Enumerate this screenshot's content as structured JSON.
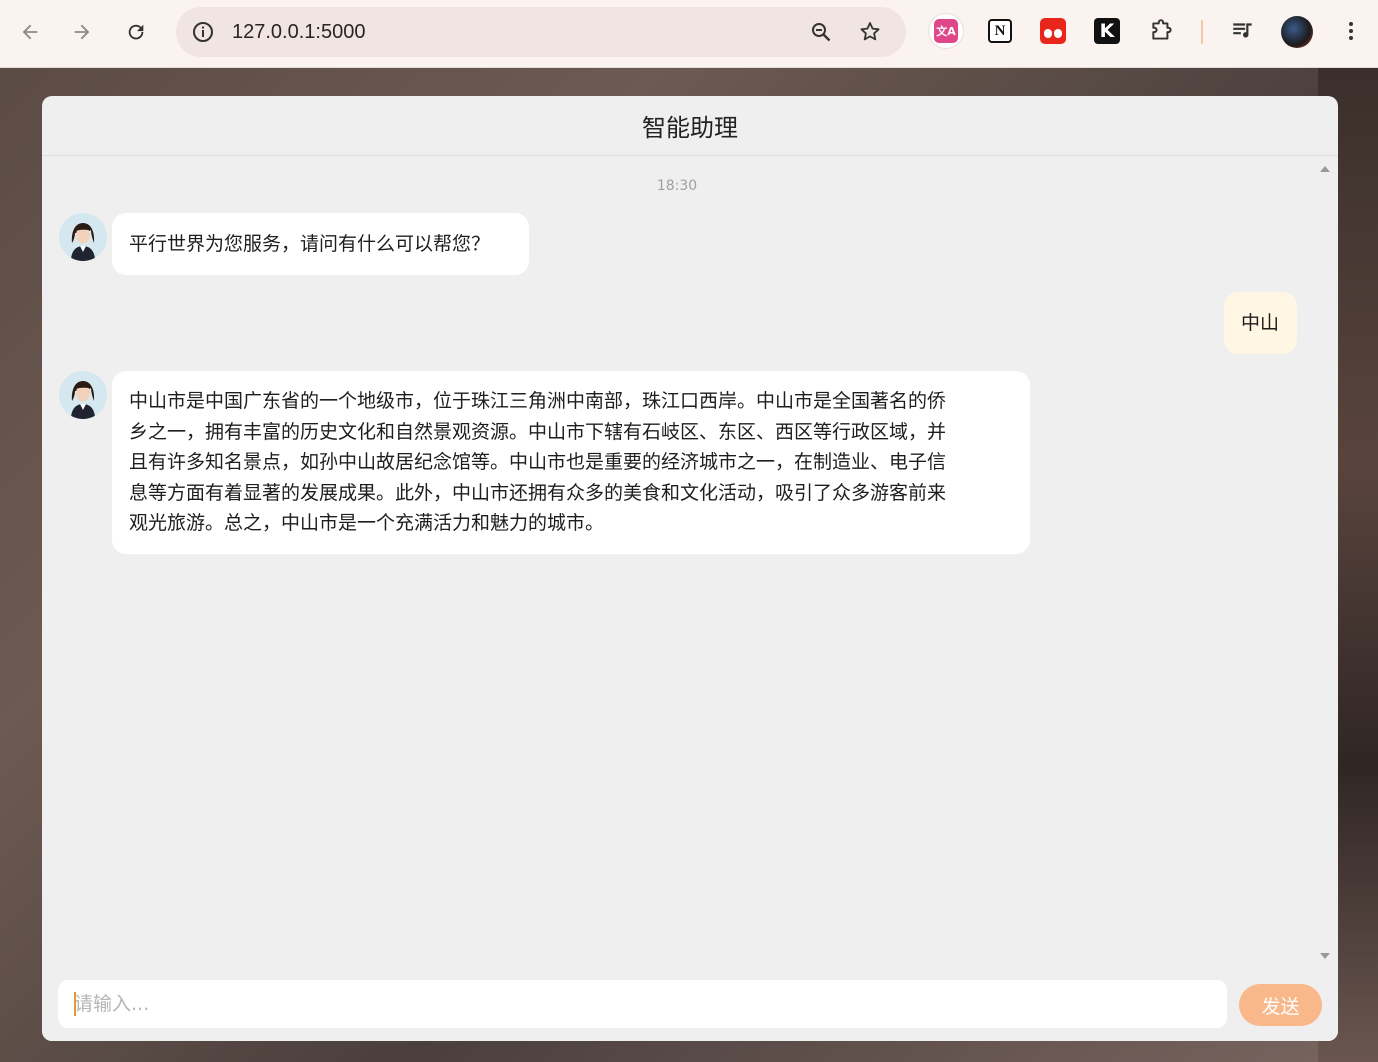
{
  "browser": {
    "url": "127.0.0.1:5000",
    "extensions": [
      "translate-extension-icon",
      "notion-icon",
      "tab-extension-icon",
      "k-extension-icon",
      "puzzle-icon",
      "media-control-icon",
      "profile-avatar",
      "menu-kebab-icon"
    ]
  },
  "chat": {
    "title": "智能助理",
    "timestamp": "18:30",
    "messages": [
      {
        "role": "assistant",
        "text": "平行世界为您服务，请问有什么可以帮您？"
      },
      {
        "role": "user",
        "text": "中山"
      },
      {
        "role": "assistant",
        "lines": [
          "中山市是中国广东省的一个地级市，位于珠江三角洲中南部，珠江口西岸。中山市是全国著名的侨",
          "乡之一，拥有丰富的历史文化和自然景观资源。中山市下辖有石岐区、东区、西区等行政区域，并",
          "且有许多知名景点，如孙中山故居纪念馆等。中山市也是重要的经济城市之一，在制造业、电子信",
          "息等方面有着显著的发展成果。此外，中山市还拥有众多的美食和文化活动，吸引了众多游客前来",
          "观光旅游。总之，中山市是一个充满活力和魅力的城市。"
        ]
      }
    ]
  },
  "composer": {
    "placeholder": "请输入...",
    "send_label": "发送"
  },
  "colors": {
    "send_button": "#f8b88a",
    "user_bubble": "#fff6e3",
    "caret": "#e09a3a"
  }
}
